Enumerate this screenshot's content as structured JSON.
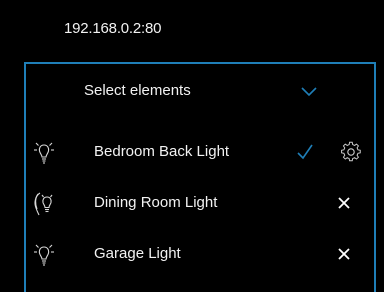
{
  "address": "192.168.0.2:80",
  "selector": {
    "label": "Select elements",
    "icon": "chevron-down-icon",
    "accent": "#1f7fb8"
  },
  "elements": [
    {
      "label": "Bedroom Back Light",
      "icon": "bulb-icon",
      "state": "selected",
      "state_icon": "checkmark-icon",
      "extra_icon": "gear-icon"
    },
    {
      "label": "Dining Room Light",
      "icon": "hand-bulb-icon",
      "state": "unselected",
      "state_icon": "close-icon"
    },
    {
      "label": "Garage Light",
      "icon": "bulb-icon",
      "state": "unselected",
      "state_icon": "close-icon"
    }
  ]
}
